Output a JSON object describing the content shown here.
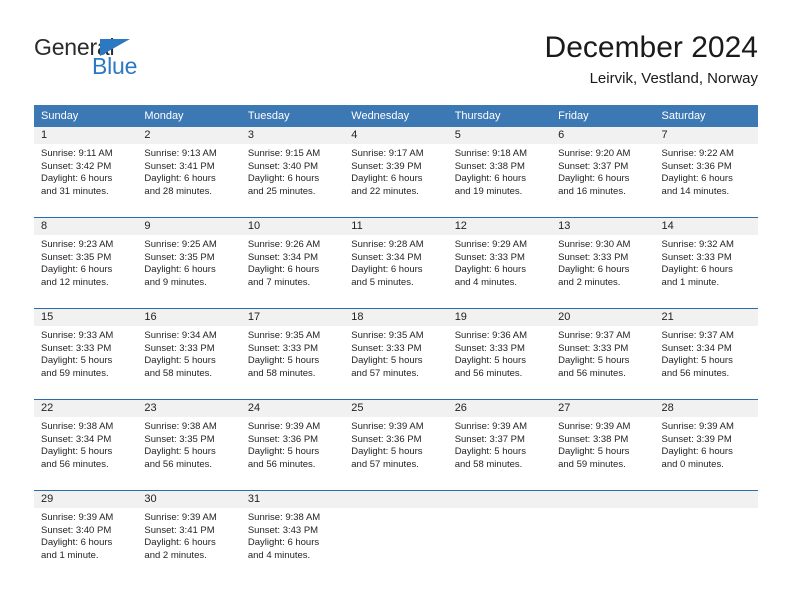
{
  "brand": {
    "name_top": "General",
    "name_bottom": "Blue",
    "triangle_icon": "triangle-icon",
    "color_blue": "#2b79c2",
    "color_dark": "#2b2b2b"
  },
  "header": {
    "title": "December 2024",
    "subtitle": "Leirvik, Vestland, Norway"
  },
  "theme": {
    "header_row_bg": "#3b78b4",
    "header_row_text": "#ffffff",
    "daynum_band_bg": "#f1f1f1",
    "row_separator": "#2b6ca8",
    "body_text": "#231f20"
  },
  "weekdays": [
    "Sunday",
    "Monday",
    "Tuesday",
    "Wednesday",
    "Thursday",
    "Friday",
    "Saturday"
  ],
  "weeks": [
    [
      {
        "day": "1",
        "sunrise": "Sunrise: 9:11 AM",
        "sunset": "Sunset: 3:42 PM",
        "daylight_1": "Daylight: 6 hours",
        "daylight_2": "and 31 minutes."
      },
      {
        "day": "2",
        "sunrise": "Sunrise: 9:13 AM",
        "sunset": "Sunset: 3:41 PM",
        "daylight_1": "Daylight: 6 hours",
        "daylight_2": "and 28 minutes."
      },
      {
        "day": "3",
        "sunrise": "Sunrise: 9:15 AM",
        "sunset": "Sunset: 3:40 PM",
        "daylight_1": "Daylight: 6 hours",
        "daylight_2": "and 25 minutes."
      },
      {
        "day": "4",
        "sunrise": "Sunrise: 9:17 AM",
        "sunset": "Sunset: 3:39 PM",
        "daylight_1": "Daylight: 6 hours",
        "daylight_2": "and 22 minutes."
      },
      {
        "day": "5",
        "sunrise": "Sunrise: 9:18 AM",
        "sunset": "Sunset: 3:38 PM",
        "daylight_1": "Daylight: 6 hours",
        "daylight_2": "and 19 minutes."
      },
      {
        "day": "6",
        "sunrise": "Sunrise: 9:20 AM",
        "sunset": "Sunset: 3:37 PM",
        "daylight_1": "Daylight: 6 hours",
        "daylight_2": "and 16 minutes."
      },
      {
        "day": "7",
        "sunrise": "Sunrise: 9:22 AM",
        "sunset": "Sunset: 3:36 PM",
        "daylight_1": "Daylight: 6 hours",
        "daylight_2": "and 14 minutes."
      }
    ],
    [
      {
        "day": "8",
        "sunrise": "Sunrise: 9:23 AM",
        "sunset": "Sunset: 3:35 PM",
        "daylight_1": "Daylight: 6 hours",
        "daylight_2": "and 12 minutes."
      },
      {
        "day": "9",
        "sunrise": "Sunrise: 9:25 AM",
        "sunset": "Sunset: 3:35 PM",
        "daylight_1": "Daylight: 6 hours",
        "daylight_2": "and 9 minutes."
      },
      {
        "day": "10",
        "sunrise": "Sunrise: 9:26 AM",
        "sunset": "Sunset: 3:34 PM",
        "daylight_1": "Daylight: 6 hours",
        "daylight_2": "and 7 minutes."
      },
      {
        "day": "11",
        "sunrise": "Sunrise: 9:28 AM",
        "sunset": "Sunset: 3:34 PM",
        "daylight_1": "Daylight: 6 hours",
        "daylight_2": "and 5 minutes."
      },
      {
        "day": "12",
        "sunrise": "Sunrise: 9:29 AM",
        "sunset": "Sunset: 3:33 PM",
        "daylight_1": "Daylight: 6 hours",
        "daylight_2": "and 4 minutes."
      },
      {
        "day": "13",
        "sunrise": "Sunrise: 9:30 AM",
        "sunset": "Sunset: 3:33 PM",
        "daylight_1": "Daylight: 6 hours",
        "daylight_2": "and 2 minutes."
      },
      {
        "day": "14",
        "sunrise": "Sunrise: 9:32 AM",
        "sunset": "Sunset: 3:33 PM",
        "daylight_1": "Daylight: 6 hours",
        "daylight_2": "and 1 minute."
      }
    ],
    [
      {
        "day": "15",
        "sunrise": "Sunrise: 9:33 AM",
        "sunset": "Sunset: 3:33 PM",
        "daylight_1": "Daylight: 5 hours",
        "daylight_2": "and 59 minutes."
      },
      {
        "day": "16",
        "sunrise": "Sunrise: 9:34 AM",
        "sunset": "Sunset: 3:33 PM",
        "daylight_1": "Daylight: 5 hours",
        "daylight_2": "and 58 minutes."
      },
      {
        "day": "17",
        "sunrise": "Sunrise: 9:35 AM",
        "sunset": "Sunset: 3:33 PM",
        "daylight_1": "Daylight: 5 hours",
        "daylight_2": "and 58 minutes."
      },
      {
        "day": "18",
        "sunrise": "Sunrise: 9:35 AM",
        "sunset": "Sunset: 3:33 PM",
        "daylight_1": "Daylight: 5 hours",
        "daylight_2": "and 57 minutes."
      },
      {
        "day": "19",
        "sunrise": "Sunrise: 9:36 AM",
        "sunset": "Sunset: 3:33 PM",
        "daylight_1": "Daylight: 5 hours",
        "daylight_2": "and 56 minutes."
      },
      {
        "day": "20",
        "sunrise": "Sunrise: 9:37 AM",
        "sunset": "Sunset: 3:33 PM",
        "daylight_1": "Daylight: 5 hours",
        "daylight_2": "and 56 minutes."
      },
      {
        "day": "21",
        "sunrise": "Sunrise: 9:37 AM",
        "sunset": "Sunset: 3:34 PM",
        "daylight_1": "Daylight: 5 hours",
        "daylight_2": "and 56 minutes."
      }
    ],
    [
      {
        "day": "22",
        "sunrise": "Sunrise: 9:38 AM",
        "sunset": "Sunset: 3:34 PM",
        "daylight_1": "Daylight: 5 hours",
        "daylight_2": "and 56 minutes."
      },
      {
        "day": "23",
        "sunrise": "Sunrise: 9:38 AM",
        "sunset": "Sunset: 3:35 PM",
        "daylight_1": "Daylight: 5 hours",
        "daylight_2": "and 56 minutes."
      },
      {
        "day": "24",
        "sunrise": "Sunrise: 9:39 AM",
        "sunset": "Sunset: 3:36 PM",
        "daylight_1": "Daylight: 5 hours",
        "daylight_2": "and 56 minutes."
      },
      {
        "day": "25",
        "sunrise": "Sunrise: 9:39 AM",
        "sunset": "Sunset: 3:36 PM",
        "daylight_1": "Daylight: 5 hours",
        "daylight_2": "and 57 minutes."
      },
      {
        "day": "26",
        "sunrise": "Sunrise: 9:39 AM",
        "sunset": "Sunset: 3:37 PM",
        "daylight_1": "Daylight: 5 hours",
        "daylight_2": "and 58 minutes."
      },
      {
        "day": "27",
        "sunrise": "Sunrise: 9:39 AM",
        "sunset": "Sunset: 3:38 PM",
        "daylight_1": "Daylight: 5 hours",
        "daylight_2": "and 59 minutes."
      },
      {
        "day": "28",
        "sunrise": "Sunrise: 9:39 AM",
        "sunset": "Sunset: 3:39 PM",
        "daylight_1": "Daylight: 6 hours",
        "daylight_2": "and 0 minutes."
      }
    ],
    [
      {
        "day": "29",
        "sunrise": "Sunrise: 9:39 AM",
        "sunset": "Sunset: 3:40 PM",
        "daylight_1": "Daylight: 6 hours",
        "daylight_2": "and 1 minute."
      },
      {
        "day": "30",
        "sunrise": "Sunrise: 9:39 AM",
        "sunset": "Sunset: 3:41 PM",
        "daylight_1": "Daylight: 6 hours",
        "daylight_2": "and 2 minutes."
      },
      {
        "day": "31",
        "sunrise": "Sunrise: 9:38 AM",
        "sunset": "Sunset: 3:43 PM",
        "daylight_1": "Daylight: 6 hours",
        "daylight_2": "and 4 minutes."
      },
      {
        "day": "",
        "sunrise": "",
        "sunset": "",
        "daylight_1": "",
        "daylight_2": ""
      },
      {
        "day": "",
        "sunrise": "",
        "sunset": "",
        "daylight_1": "",
        "daylight_2": ""
      },
      {
        "day": "",
        "sunrise": "",
        "sunset": "",
        "daylight_1": "",
        "daylight_2": ""
      },
      {
        "day": "",
        "sunrise": "",
        "sunset": "",
        "daylight_1": "",
        "daylight_2": ""
      }
    ]
  ]
}
